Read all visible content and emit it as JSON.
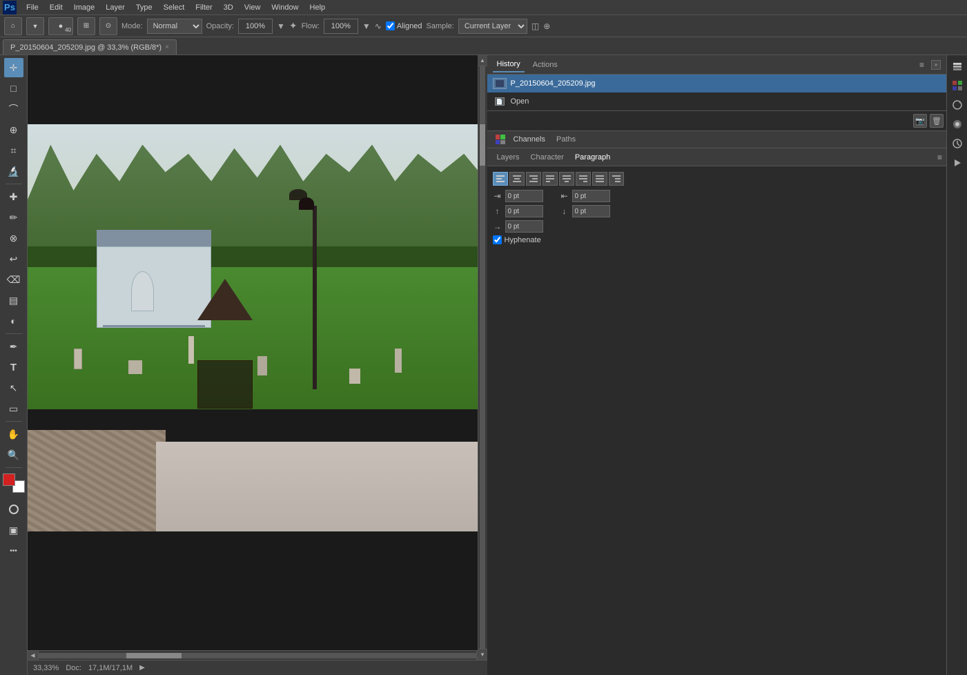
{
  "app": {
    "logo": "Ps",
    "title": "Photoshop"
  },
  "menu": {
    "items": [
      "File",
      "Edit",
      "Image",
      "Layer",
      "Type",
      "Select",
      "Filter",
      "3D",
      "View",
      "Window",
      "Help"
    ]
  },
  "options_bar": {
    "mode_label": "Mode:",
    "mode_value": "Normal",
    "opacity_label": "Opacity:",
    "opacity_value": "100%",
    "flow_label": "Flow:",
    "flow_value": "100%",
    "aligned_label": "Aligned",
    "sample_label": "Sample:",
    "sample_value": "Current Layer",
    "brush_size": "40"
  },
  "tab": {
    "filename": "P_20150604_205209.jpg @ 33,3% (RGB/8*)",
    "close_label": "×"
  },
  "history_panel": {
    "tab_label": "History",
    "actions_tab_label": "Actions",
    "menu_icon": "≡",
    "items": [
      {
        "label": "P_20150604_205209.jpg",
        "type": "file"
      },
      {
        "label": "Open",
        "type": "action"
      }
    ]
  },
  "channels_panel": {
    "label": "Channels"
  },
  "paths_panel": {
    "label": "Paths"
  },
  "bottom_tabs": {
    "layers_label": "Layers",
    "character_label": "Character",
    "paragraph_label": "Paragraph",
    "menu_icon": "≡"
  },
  "paragraph_panel": {
    "align_buttons": [
      "align-left",
      "align-center",
      "align-right",
      "justify-left",
      "justify-center",
      "justify-right",
      "justify-full",
      "align-last-right"
    ],
    "indent_left_icon": "⇥",
    "indent_right_icon": "⇤",
    "indent_left_value": "0 pt",
    "indent_right_value": "0 pt",
    "space_before_icon": "↕",
    "space_before_value": "0 pt",
    "space_after_icon": "↕",
    "space_after_value": "0 pt",
    "indent_first_icon": "→",
    "indent_first_value": "0 pt",
    "hyphenate_label": "Hyphenate"
  },
  "status_bar": {
    "zoom": "33,33%",
    "doc_label": "Doc:",
    "doc_value": "17,1M/17,1M",
    "arrow_label": "▶"
  },
  "tools": {
    "move": "✛",
    "marquee_rect": "□",
    "marquee_lasso": "○",
    "quick_select": "◈",
    "crop": "⌗",
    "eyedropper": "⊕",
    "healing": "✚",
    "brush": "✎",
    "clone": "⊜",
    "history_brush": "⌚",
    "eraser": "⌫",
    "gradient": "▦",
    "dodge": "◐",
    "pen": "✒",
    "text": "T",
    "path_select": "↖",
    "shape": "▭",
    "hand": "✋",
    "zoom": "⊕",
    "more": "…"
  },
  "panel_bottom_icons": {
    "new_snapshot": "📷",
    "delete": "🗑"
  }
}
